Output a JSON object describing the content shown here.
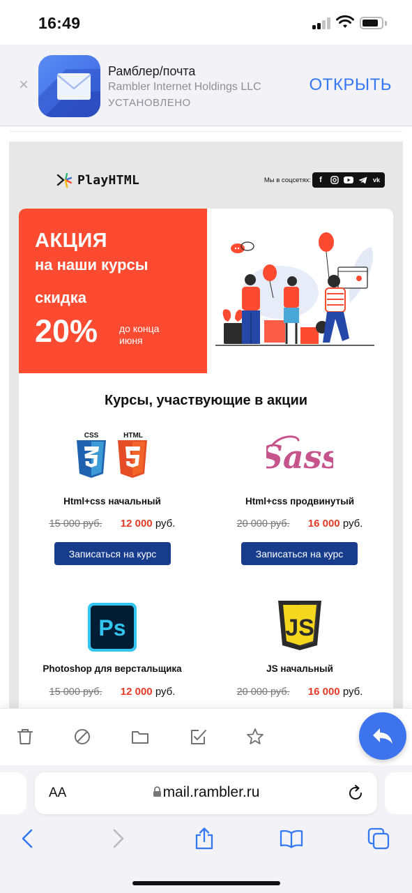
{
  "status_bar": {
    "time": "16:49"
  },
  "app_banner": {
    "close": "×",
    "name": "Рамблер/почта",
    "company": "Rambler Internet Holdings LLC",
    "status": "УСТАНОВЛЕНО",
    "open_label": "ОТКРЫТЬ"
  },
  "email": {
    "logo_text": "PlayHTML",
    "social_label": "Мы в соцсетях:",
    "social_icons": [
      "facebook-icon",
      "instagram-icon",
      "youtube-icon",
      "telegram-icon",
      "vk-icon"
    ],
    "promo": {
      "title": "АКЦИЯ",
      "subtitle": "на наши курсы",
      "discount_label": "скидка",
      "percent": "20%",
      "until": "до конца июня"
    },
    "courses_title": "Курсы, участвующие в акции",
    "courses": [
      {
        "logo": "css-html-logo",
        "name": "Html+css начальный",
        "old_price": "15 000 руб.",
        "new_price": "12 000",
        "currency": "руб.",
        "button": "Записаться на курс"
      },
      {
        "logo": "sass-logo",
        "name": "Html+css продвинутый",
        "old_price": "20 000 руб.",
        "new_price": "16 000",
        "currency": "руб.",
        "button": "Записаться на курс"
      },
      {
        "logo": "photoshop-logo",
        "name": "Photoshop для верстальщика",
        "old_price": "15 000 руб.",
        "new_price": "12 000",
        "currency": "руб."
      },
      {
        "logo": "js-logo",
        "name": "JS начальный",
        "old_price": "20 000 руб.",
        "new_price": "16 000",
        "currency": "руб."
      }
    ],
    "logo_texts": {
      "css": "CSS",
      "html": "HTML",
      "sass": "Sass",
      "ps": "Ps",
      "js": "JS"
    }
  },
  "mail_toolbar": {
    "icons": [
      "trash-icon",
      "spam-icon",
      "folder-icon",
      "mark-read-icon",
      "star-icon"
    ],
    "reply_icon": "reply-icon"
  },
  "safari": {
    "text_size": "AA",
    "url": "mail.rambler.ru",
    "buttons": [
      "back-icon",
      "forward-icon",
      "share-icon",
      "bookmarks-icon",
      "tabs-icon"
    ]
  },
  "colors": {
    "promo": "#fd4b32",
    "price_red": "#e63a26",
    "button_blue": "#173c8c",
    "ios_blue": "#3478f6",
    "fab_blue": "#3d73ed"
  }
}
